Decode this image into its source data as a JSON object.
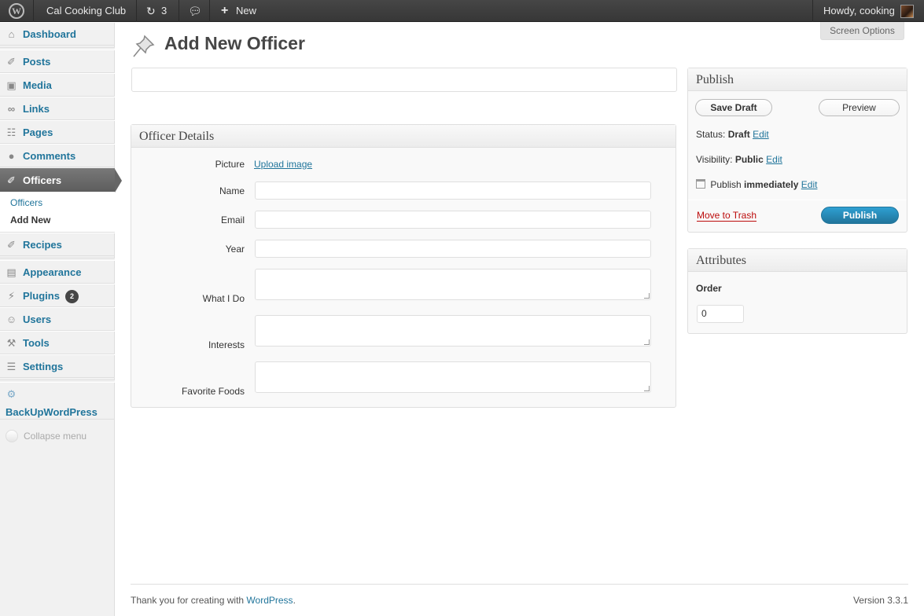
{
  "adminbar": {
    "site_name": "Cal Cooking Club",
    "updates_count": "3",
    "new_label": "New",
    "howdy": "Howdy, cooking"
  },
  "sidebar": {
    "items": [
      {
        "label": "Dashboard",
        "icon": "dashboard-icon"
      },
      {
        "label": "Posts",
        "icon": "pushpin-icon"
      },
      {
        "label": "Media",
        "icon": "media-icon"
      },
      {
        "label": "Links",
        "icon": "link-icon"
      },
      {
        "label": "Pages",
        "icon": "page-icon"
      },
      {
        "label": "Comments",
        "icon": "comment-icon"
      },
      {
        "label": "Officers",
        "icon": "pushpin-icon"
      },
      {
        "label": "Recipes",
        "icon": "pushpin-icon"
      },
      {
        "label": "Appearance",
        "icon": "appearance-icon"
      },
      {
        "label": "Plugins",
        "icon": "plugin-icon",
        "badge": "2"
      },
      {
        "label": "Users",
        "icon": "users-icon"
      },
      {
        "label": "Tools",
        "icon": "tools-icon"
      },
      {
        "label": "Settings",
        "icon": "settings-icon"
      },
      {
        "label": "BackUpWordPress",
        "icon": "backup-icon"
      }
    ],
    "submenu": [
      "Officers",
      "Add New"
    ],
    "collapse_label": "Collapse menu"
  },
  "screen_options": "Screen Options",
  "page_title": "Add New Officer",
  "title_input": {
    "value": "",
    "placeholder": ""
  },
  "officer_details": {
    "heading": "Officer Details",
    "picture_label": "Picture",
    "upload_link": "Upload image",
    "name_label": "Name",
    "email_label": "Email",
    "year_label": "Year",
    "what_i_do_label": "What I Do",
    "interests_label": "Interests",
    "favorite_foods_label": "Favorite Foods"
  },
  "publish": {
    "heading": "Publish",
    "save_draft": "Save Draft",
    "preview": "Preview",
    "status_label": "Status:",
    "status_value": "Draft",
    "visibility_label": "Visibility:",
    "visibility_value": "Public",
    "publish_label": "Publish",
    "publish_value": "immediately",
    "edit": "Edit",
    "move_to_trash": "Move to Trash",
    "publish_button": "Publish"
  },
  "attributes": {
    "heading": "Attributes",
    "order_label": "Order",
    "order_value": "0"
  },
  "footer": {
    "thanks_prefix": "Thank you for creating with",
    "wordpress_link": "WordPress",
    "thanks_suffix": ".",
    "version": "Version 3.3.1"
  },
  "colors": {
    "link": "#21759b",
    "trash": "#bc0b0b",
    "adminbar": "#464646"
  }
}
